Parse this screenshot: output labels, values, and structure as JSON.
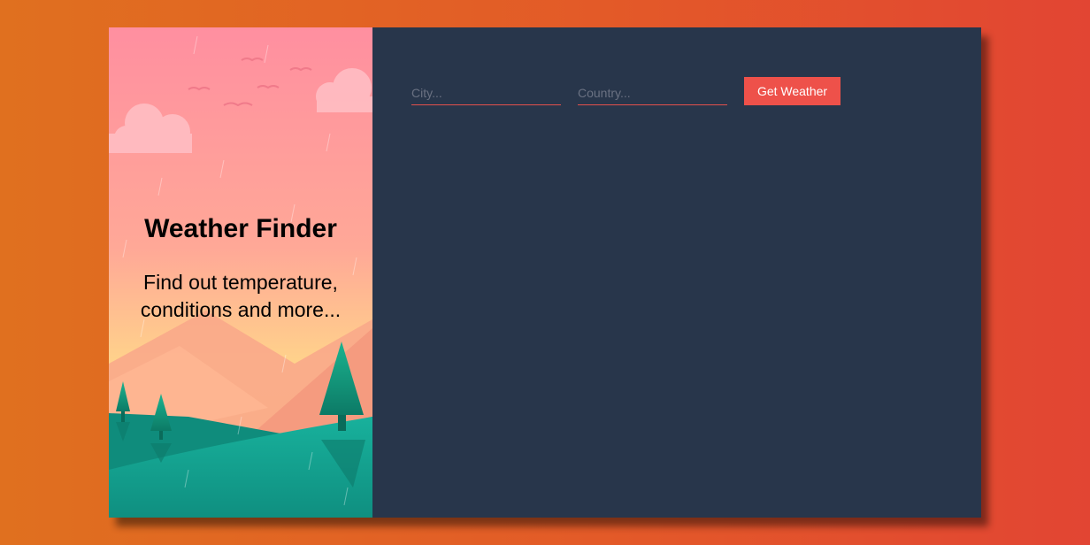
{
  "hero": {
    "title": "Weather Finder",
    "subtitle": "Find out temperature, conditions and more..."
  },
  "form": {
    "city_placeholder": "City...",
    "country_placeholder": "Country...",
    "submit_label": "Get Weather"
  },
  "colors": {
    "page_gradient_start": "#e0701f",
    "page_gradient_end": "#e24533",
    "panel_background": "#28364b",
    "accent": "#ee514a",
    "sky_top": "#ff8fa0",
    "sky_bottom": "#ffd58a",
    "hill_teal": "#14a492"
  }
}
